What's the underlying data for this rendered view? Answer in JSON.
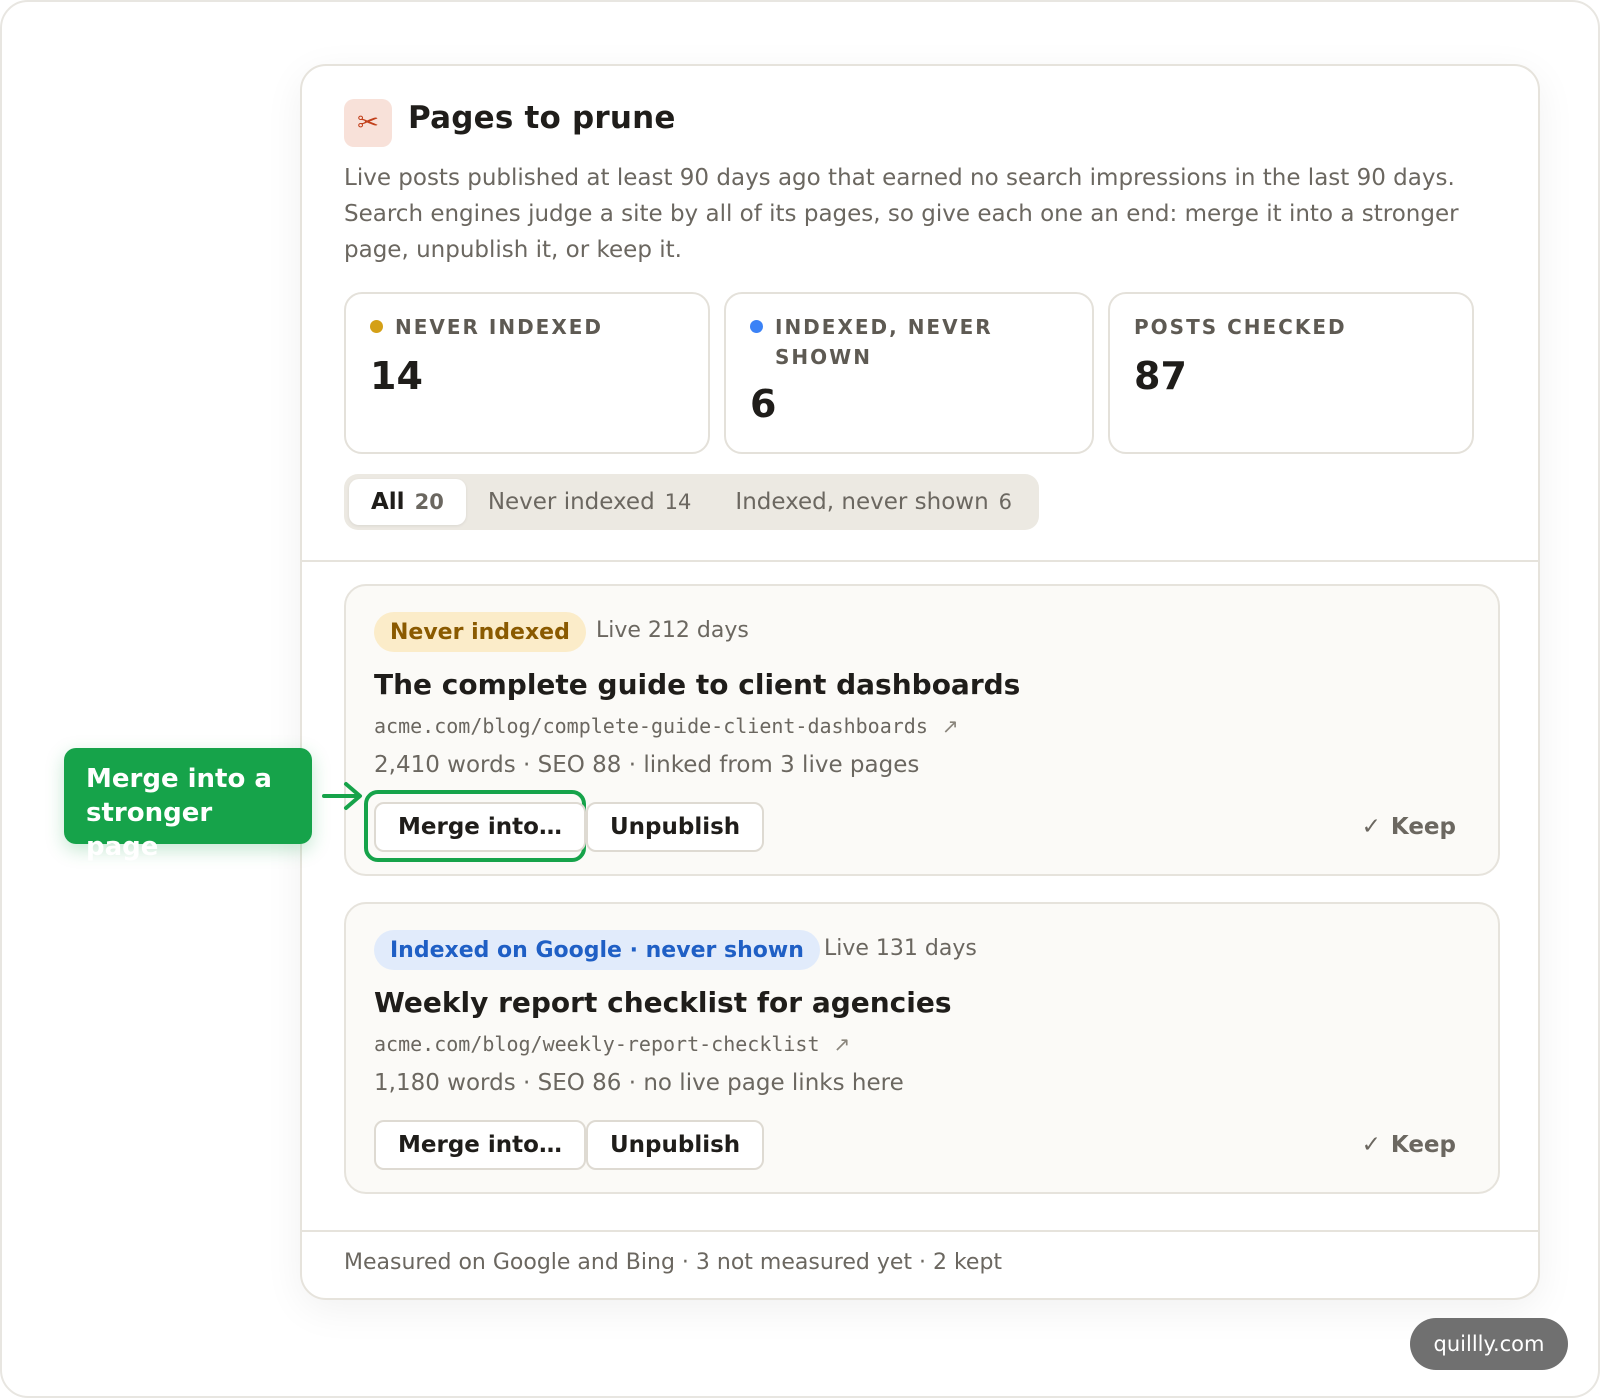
{
  "header": {
    "icon": "scissors-icon",
    "title": "Pages to prune",
    "description": "Live posts published at least 90 days ago that earned no search impressions in the last 90 days. Search engines judge a site by all of its pages, so give each one an end: merge it into a stronger page, unpublish it, or keep it."
  },
  "stats": [
    {
      "label": "Never indexed",
      "value": "14",
      "dot_color": "#d4a017"
    },
    {
      "label": "Indexed, never shown",
      "value": "6",
      "dot_color": "#3b82f6"
    },
    {
      "label": "Posts checked",
      "value": "87"
    }
  ],
  "tabs": [
    {
      "label": "All",
      "count": "20",
      "active": true
    },
    {
      "label": "Never indexed",
      "count": "14",
      "active": false
    },
    {
      "label": "Indexed, never shown",
      "count": "6",
      "active": false
    }
  ],
  "cards": [
    {
      "badge": "Never indexed",
      "badge_style": "amber",
      "live": "Live 212 days",
      "title": "The complete guide to client dashboards",
      "url": "acme.com/blog/complete-guide-client-dashboards",
      "meta": "2,410 words · SEO 88 · linked from 3 live pages",
      "merge_label": "Merge into…",
      "unpublish_label": "Unpublish",
      "keep_label": "Keep"
    },
    {
      "badge": "Indexed on Google · never shown",
      "badge_style": "blue",
      "live": "Live 131 days",
      "title": "Weekly report checklist for agencies",
      "url": "acme.com/blog/weekly-report-checklist",
      "meta": "1,180 words · SEO 86 · no live page links here",
      "merge_label": "Merge into…",
      "unpublish_label": "Unpublish",
      "keep_label": "Keep"
    }
  ],
  "footer": {
    "text": "Measured on Google and Bing · 3 not measured yet · 2 kept"
  },
  "callout": {
    "text": "Merge into a stronger page",
    "color": "#16a34a"
  },
  "watermark": {
    "text": "quillly.com"
  },
  "icons": {
    "external_link": "external-link-icon",
    "check": "check-icon",
    "arrow": "arrow-right-icon"
  }
}
